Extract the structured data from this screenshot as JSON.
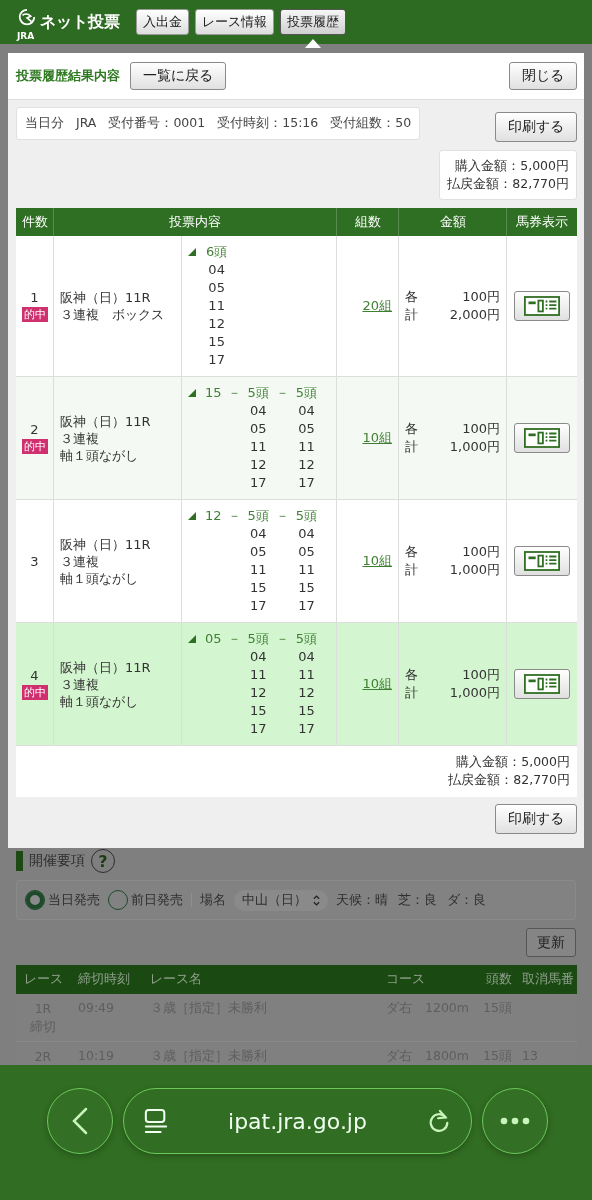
{
  "header": {
    "logo_text": "ネット投票",
    "logo_sub": "JRA",
    "nav": [
      {
        "label": "入出金",
        "selected": false
      },
      {
        "label": "レース情報",
        "selected": false
      },
      {
        "label": "投票履歴",
        "selected": true
      }
    ]
  },
  "modal": {
    "title": "投票履歴結果内容",
    "back_button": "一覧に戻る",
    "close_button": "閉じる",
    "receipt": [
      "当日分",
      "JRA",
      "受付番号：0001",
      "受付時刻：15:16",
      "受付組数：50"
    ],
    "print_button": "印刷する",
    "totals": [
      "購入金額：5,000円",
      "払戻金額：82,770円"
    ],
    "table": {
      "columns": [
        "件数",
        "投票内容",
        "組数",
        "金額",
        "馬券表示"
      ],
      "rows": [
        {
          "no": "1",
          "hit_badge": "的中",
          "highlighted": false,
          "race": [
            "阪神（日）11R",
            "３連複　ボックス"
          ],
          "selection": [
            {
              "text": "6頭",
              "horses": [
                "04",
                "05",
                "11",
                "12",
                "15",
                "17"
              ]
            }
          ],
          "combos": "20組",
          "each_label": "各",
          "each": "100円",
          "total_label": "計",
          "total": "2,000円"
        },
        {
          "no": "2",
          "hit_badge": "的中",
          "highlighted": false,
          "race": [
            "阪神（日）11R",
            "３連複",
            "軸１頭ながし"
          ],
          "selection": [
            {
              "text": "15"
            },
            {
              "text": "－"
            },
            {
              "text": "5頭",
              "horses": [
                "04",
                "05",
                "11",
                "12",
                "17"
              ]
            },
            {
              "text": "－"
            },
            {
              "text": "5頭",
              "horses": [
                "04",
                "05",
                "11",
                "12",
                "17"
              ]
            }
          ],
          "combos": "10組",
          "each_label": "各",
          "each": "100円",
          "total_label": "計",
          "total": "1,000円"
        },
        {
          "no": "3",
          "highlighted": false,
          "race": [
            "阪神（日）11R",
            "３連複",
            "軸１頭ながし"
          ],
          "selection": [
            {
              "text": "12"
            },
            {
              "text": "－"
            },
            {
              "text": "5頭",
              "horses": [
                "04",
                "05",
                "11",
                "15",
                "17"
              ]
            },
            {
              "text": "－"
            },
            {
              "text": "5頭",
              "horses": [
                "04",
                "05",
                "11",
                "15",
                "17"
              ]
            }
          ],
          "combos": "10組",
          "each_label": "各",
          "each": "100円",
          "total_label": "計",
          "total": "1,000円"
        },
        {
          "no": "4",
          "hit_badge": "的中",
          "highlighted": true,
          "race": [
            "阪神（日）11R",
            "３連複",
            "軸１頭ながし"
          ],
          "selection": [
            {
              "text": "05"
            },
            {
              "text": "－"
            },
            {
              "text": "5頭",
              "horses": [
                "04",
                "11",
                "12",
                "15",
                "17"
              ]
            },
            {
              "text": "－"
            },
            {
              "text": "5頭",
              "horses": [
                "04",
                "11",
                "12",
                "15",
                "17"
              ]
            }
          ],
          "combos": "10組",
          "each_label": "各",
          "each": "100円",
          "total_label": "計",
          "total": "1,000円"
        }
      ]
    },
    "totals_bottom": [
      "購入金額：5,000円",
      "払戻金額：82,770円"
    ],
    "print_button_bottom": "印刷する"
  },
  "background": {
    "section_title": "開催要項",
    "help": "?",
    "sale": [
      {
        "label": "当日発売",
        "selected": true
      },
      {
        "label": "前日発売",
        "selected": false
      }
    ],
    "venue_label": "場名",
    "venue": "中山（日）",
    "conditions": [
      "天候：晴",
      "芝：良",
      "ダ：良"
    ],
    "refresh_button": "更新",
    "races": {
      "columns": [
        "レース",
        "締切時刻",
        "レース名",
        "コース",
        "頭数",
        "取消馬番"
      ],
      "rows": [
        {
          "race": "1R",
          "status": "締切",
          "time": "09:49",
          "name": "３歳［指定］未勝利",
          "course": "ダ右　1200m",
          "runners": "15頭"
        },
        {
          "race": "2R",
          "time": "10:19",
          "name": "３歳［指定］未勝利",
          "course": "ダ右　1800m",
          "runners": "15頭",
          "scratched": "13"
        }
      ]
    }
  },
  "browser": {
    "url": "ipat.jra.go.jp"
  }
}
